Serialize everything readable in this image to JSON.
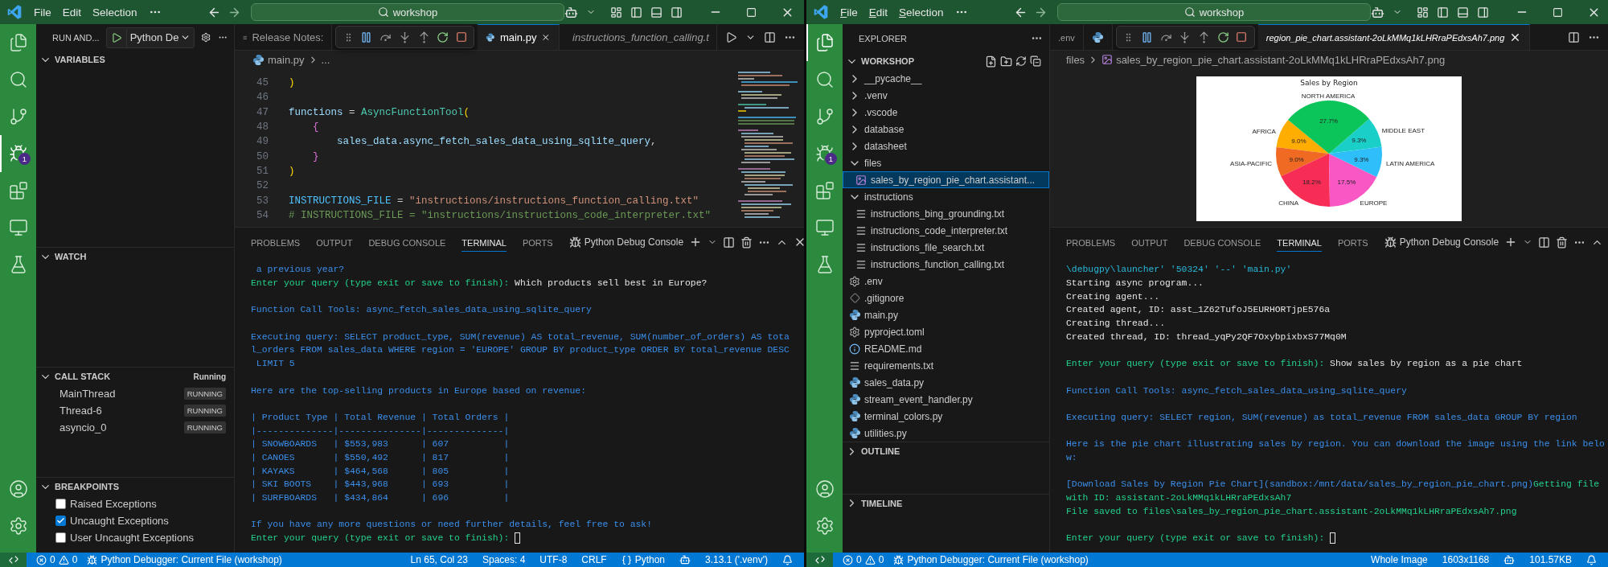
{
  "left_window": {
    "title_bar": {
      "menu": [
        "File",
        "Edit",
        "Selection"
      ],
      "mnemonics": false,
      "search": "workshop"
    },
    "activity_bar": {
      "items": [
        {
          "kind": "explorer",
          "selected": false
        },
        {
          "kind": "search",
          "selected": false
        },
        {
          "kind": "source_control",
          "selected": false
        },
        {
          "kind": "run_debug",
          "selected": true,
          "badge": "1"
        },
        {
          "kind": "extensions",
          "selected": false
        },
        {
          "kind": "remote",
          "selected": false
        },
        {
          "kind": "testing",
          "selected": false
        }
      ]
    },
    "run_panel": {
      "title": "RUN AND...",
      "configuration": "Python De",
      "variables": {
        "title": "VARIABLES",
        "expanded": true
      },
      "watch": {
        "title": "WATCH",
        "expanded": true
      },
      "call_stack": {
        "title": "CALL STACK",
        "expanded": true,
        "status": "Running",
        "threads": [
          {
            "name": "MainThread",
            "state": "RUNNING"
          },
          {
            "name": "Thread-6",
            "state": "RUNNING"
          },
          {
            "name": "asyncio_0",
            "state": "RUNNING"
          }
        ]
      },
      "breakpoints": {
        "title": "BREAKPOINTS",
        "expanded": true,
        "items": [
          {
            "label": "Raised Exceptions",
            "checked": false
          },
          {
            "label": "Uncaught Exceptions",
            "checked": true
          },
          {
            "label": "User Uncaught Exceptions",
            "checked": false
          }
        ]
      }
    },
    "editor": {
      "tabs": [
        {
          "kind": "text",
          "label": "Release Notes:",
          "selected": false,
          "preview": false
        },
        {
          "kind": "python",
          "label": "main.py",
          "selected": true,
          "preview": false
        },
        {
          "kind": "text",
          "label": "instructions_function_calling.t",
          "selected": false,
          "preview": true
        }
      ],
      "breadcrumb": [
        {
          "kind": "python",
          "label": "main.py"
        },
        {
          "kind": "plain",
          "label": "..."
        }
      ],
      "code": [
        {
          "number": "45",
          "tokens": [
            {
              "kind": "bracket",
              "text": ")"
            }
          ]
        },
        {
          "number": "46"
        },
        {
          "number": "47",
          "tokens": [
            {
              "kind": "variable",
              "text": "functions"
            },
            {
              "kind": "plain",
              "text": " = "
            },
            {
              "kind": "class",
              "text": "AsyncFunctionTool"
            },
            {
              "kind": "bracket",
              "text": "("
            }
          ]
        },
        {
          "number": "48",
          "tokens": [
            {
              "kind": "brace",
              "text": "    {"
            }
          ]
        },
        {
          "number": "49",
          "tokens": [
            {
              "kind": "variable",
              "text": "        sales_data.async_fetch_sales_data_using_sqlite_query"
            },
            {
              "kind": "plain",
              "text": ","
            }
          ]
        },
        {
          "number": "50",
          "tokens": [
            {
              "kind": "brace",
              "text": "    }"
            }
          ]
        },
        {
          "number": "51",
          "tokens": [
            {
              "kind": "bracket",
              "text": ")"
            }
          ]
        },
        {
          "number": "52"
        },
        {
          "number": "53",
          "tokens": [
            {
              "kind": "constant",
              "text": "INSTRUCTIONS_FILE"
            },
            {
              "kind": "plain",
              "text": " = "
            },
            {
              "kind": "string",
              "text": "\"instructions/instructions_function_calling.txt\""
            }
          ]
        },
        {
          "number": "54",
          "tokens": [
            {
              "kind": "comment",
              "text": "# INSTRUCTIONS_FILE = \"instructions/instructions_code_interpreter.txt\""
            }
          ]
        }
      ]
    },
    "panel": {
      "tabs": [
        {
          "label": "PROBLEMS",
          "selected": false
        },
        {
          "label": "OUTPUT",
          "selected": false
        },
        {
          "label": "DEBUG CONSOLE",
          "selected": false
        },
        {
          "label": "TERMINAL",
          "selected": true
        },
        {
          "label": "PORTS",
          "selected": false
        }
      ],
      "terminal": "Python Debug Console",
      "lines": [
        {
          "kind": "text",
          "segments": [
            {
              "kind": "info",
              "text": " a previous year?"
            }
          ]
        },
        {
          "kind": "text",
          "segments": [
            {
              "kind": "prompt",
              "text": "Enter your query (type exit or save to finish): "
            },
            {
              "kind": "input",
              "text": "Which products sell best in Europe?"
            }
          ]
        },
        {
          "kind": "blank"
        },
        {
          "kind": "text",
          "segments": [
            {
              "kind": "info",
              "text": "Function Call Tools: async_fetch_sales_data_using_sqlite_query"
            }
          ]
        },
        {
          "kind": "blank"
        },
        {
          "kind": "text",
          "segments": [
            {
              "kind": "info",
              "text": "Executing query: SELECT product_type, SUM(revenue) AS total_revenue, SUM(number_of_orders) AS tota"
            }
          ]
        },
        {
          "kind": "text",
          "segments": [
            {
              "kind": "info",
              "text": "l_orders FROM sales_data WHERE region = 'EUROPE' GROUP BY product_type ORDER BY total_revenue DESC"
            }
          ]
        },
        {
          "kind": "text",
          "segments": [
            {
              "kind": "info",
              "text": " LIMIT 5"
            }
          ]
        },
        {
          "kind": "blank"
        },
        {
          "kind": "text",
          "segments": [
            {
              "kind": "info",
              "text": "Here are the top-selling products in Europe based on revenue:"
            }
          ]
        },
        {
          "kind": "blank"
        },
        {
          "kind": "text",
          "segments": [
            {
              "kind": "info",
              "text": "| Product Type | Total Revenue | Total Orders |"
            }
          ]
        },
        {
          "kind": "text",
          "segments": [
            {
              "kind": "info",
              "text": "|--------------|---------------|--------------|"
            }
          ]
        },
        {
          "kind": "text",
          "segments": [
            {
              "kind": "info",
              "text": "| SNOWBOARDS   | $553,983      | 607          |"
            }
          ]
        },
        {
          "kind": "text",
          "segments": [
            {
              "kind": "info",
              "text": "| CANOES       | $550,492      | 817          |"
            }
          ]
        },
        {
          "kind": "text",
          "segments": [
            {
              "kind": "info",
              "text": "| KAYAKS       | $464,568      | 805          |"
            }
          ]
        },
        {
          "kind": "text",
          "segments": [
            {
              "kind": "info",
              "text": "| SKI BOOTS    | $443,968      | 693          |"
            }
          ]
        },
        {
          "kind": "text",
          "segments": [
            {
              "kind": "info",
              "text": "| SURFBOARDS   | $434,864      | 696          |"
            }
          ]
        },
        {
          "kind": "blank"
        },
        {
          "kind": "text",
          "segments": [
            {
              "kind": "info",
              "text": "If you have any more questions or need further details, feel free to ask!"
            }
          ]
        },
        {
          "kind": "text",
          "segments": [
            {
              "kind": "prompt",
              "text": "Enter your query (type exit or save to finish): "
            }
          ],
          "cursor": true
        }
      ]
    },
    "status_bar": {
      "left": [
        {
          "kind": "remote"
        },
        {
          "kind": "problems",
          "errors": "0",
          "warnings": "0"
        },
        {
          "kind": "debug",
          "text": "Python Debugger: Current File (workshop)"
        }
      ],
      "right": [
        {
          "kind": "text",
          "text": "Ln 65, Col 23"
        },
        {
          "kind": "text",
          "text": "Spaces: 4"
        },
        {
          "kind": "text",
          "text": "UTF-8"
        },
        {
          "kind": "text",
          "text": "CRLF"
        },
        {
          "kind": "language",
          "text": "Python"
        },
        {
          "kind": "copilot"
        },
        {
          "kind": "text",
          "text": "3.13.1 ('.venv')"
        },
        {
          "kind": "bell"
        }
      ]
    }
  },
  "right_window": {
    "title_bar": {
      "menu": [
        "File",
        "Edit",
        "Selection"
      ],
      "mnemonics": true,
      "search": "workshop"
    },
    "activity_bar": {
      "items": [
        {
          "kind": "explorer",
          "selected": true
        },
        {
          "kind": "search",
          "selected": false
        },
        {
          "kind": "source_control",
          "selected": false
        },
        {
          "kind": "run_debug",
          "selected": false,
          "badge": "1"
        },
        {
          "kind": "extensions",
          "selected": false
        },
        {
          "kind": "remote",
          "selected": false
        },
        {
          "kind": "testing",
          "selected": false
        }
      ]
    },
    "explorer": {
      "title": "EXPLORER",
      "workspace": "WORKSHOP",
      "tree": [
        {
          "kind": "folder",
          "name": "__pycache__",
          "expanded": false,
          "selected": false
        },
        {
          "kind": "folder",
          "name": ".venv",
          "expanded": false,
          "selected": false
        },
        {
          "kind": "folder",
          "name": ".vscode",
          "expanded": false,
          "selected": false
        },
        {
          "kind": "folder",
          "name": "database",
          "expanded": false,
          "selected": false
        },
        {
          "kind": "folder",
          "name": "datasheet",
          "expanded": false,
          "selected": false
        },
        {
          "kind": "folder",
          "name": "files",
          "expanded": true,
          "selected": false,
          "children": [
            {
              "kind": "image",
              "name": "sales_by_region_pie_chart.assistant...",
              "selected": true
            }
          ]
        },
        {
          "kind": "folder",
          "name": "instructions",
          "expanded": true,
          "selected": false,
          "children": [
            {
              "kind": "text",
              "name": "instructions_bing_grounding.txt",
              "selected": false
            },
            {
              "kind": "text",
              "name": "instructions_code_interpreter.txt",
              "selected": false
            },
            {
              "kind": "text",
              "name": "instructions_file_search.txt",
              "selected": false
            },
            {
              "kind": "text",
              "name": "instructions_function_calling.txt",
              "selected": false
            }
          ]
        },
        {
          "kind": "settings",
          "name": ".env",
          "selected": false
        },
        {
          "kind": "git",
          "name": ".gitignore",
          "selected": false
        },
        {
          "kind": "python",
          "name": "main.py",
          "selected": false
        },
        {
          "kind": "settings",
          "name": "pyproject.toml",
          "selected": false
        },
        {
          "kind": "info",
          "name": "README.md",
          "selected": false
        },
        {
          "kind": "text",
          "name": "requirements.txt",
          "selected": false
        },
        {
          "kind": "python",
          "name": "sales_data.py",
          "selected": false
        },
        {
          "kind": "python",
          "name": "stream_event_handler.py",
          "selected": false
        },
        {
          "kind": "python",
          "name": "terminal_colors.py",
          "selected": false
        },
        {
          "kind": "python",
          "name": "utilities.py",
          "selected": false
        }
      ],
      "outline": {
        "title": "OUTLINE",
        "expanded": false
      },
      "timeline": {
        "title": "TIMELINE",
        "expanded": false
      }
    },
    "editor": {
      "tabs": [
        {
          "kind": "plain",
          "label": ".env",
          "selected": false,
          "preview": false
        },
        {
          "kind": "python",
          "selected": false
        },
        {
          "kind": "plain",
          "label": "region_pie_chart.assistant-2oLkMMq1kLHRraPEdxsAh7.png",
          "selected": true,
          "preview": true
        }
      ],
      "breadcrumb": [
        {
          "kind": "plain",
          "label": "files"
        },
        {
          "kind": "image",
          "label": "sales_by_region_pie_chart.assistant-2oLkMMq1kLHRraPEdxsAh7.png"
        }
      ],
      "image": {
        "chart_data": {
          "type": "pie",
          "title": "Sales by Region",
          "categories": [
            "AFRICA",
            "ASIA-PACIFIC",
            "CHINA",
            "EUROPE",
            "LATIN AMERICA",
            "MIDDLE EAST",
            "NORTH AMERICA"
          ],
          "values": [
            9.0,
            9.0,
            18.2,
            17.5,
            9.3,
            9.3,
            27.7
          ],
          "colors": [
            "#ffad00",
            "#f06a24",
            "#f72d55",
            "#f857c4",
            "#2ebefa",
            "#1bcfc9",
            "#0bc45a"
          ],
          "value_labels": [
            "9.0%",
            "9.0%",
            "18.2%",
            "17.5%",
            "9.3%",
            "9.3%",
            "27.7%"
          ]
        }
      }
    },
    "panel": {
      "tabs": [
        {
          "label": "PROBLEMS",
          "selected": false
        },
        {
          "label": "OUTPUT",
          "selected": false
        },
        {
          "label": "DEBUG CONSOLE",
          "selected": false
        },
        {
          "label": "TERMINAL",
          "selected": true
        },
        {
          "label": "PORTS",
          "selected": false
        }
      ],
      "terminal": "Python Debug Console",
      "lines": [
        {
          "kind": "text",
          "segments": [
            {
              "kind": "path",
              "text": "\\debugpy\\launcher' '50324' '--' 'main.py'"
            }
          ]
        },
        {
          "kind": "text",
          "segments": [
            {
              "kind": "plain",
              "text": "Starting async program..."
            }
          ]
        },
        {
          "kind": "text",
          "segments": [
            {
              "kind": "plain",
              "text": "Creating agent..."
            }
          ]
        },
        {
          "kind": "text",
          "segments": [
            {
              "kind": "plain",
              "text": "Created agent, ID: asst_1Z62TufoJ5EURHORTjpE576a"
            }
          ]
        },
        {
          "kind": "text",
          "segments": [
            {
              "kind": "plain",
              "text": "Creating thread..."
            }
          ]
        },
        {
          "kind": "text",
          "segments": [
            {
              "kind": "plain",
              "text": "Created thread, ID: thread_yqPy2QF7OxybpixbxS77Mq0M"
            }
          ]
        },
        {
          "kind": "blank"
        },
        {
          "kind": "text",
          "segments": [
            {
              "kind": "prompt",
              "text": "Enter your query (type exit or save to finish): "
            },
            {
              "kind": "input",
              "text": "Show sales by region as a pie chart"
            }
          ]
        },
        {
          "kind": "blank"
        },
        {
          "kind": "text",
          "segments": [
            {
              "kind": "info",
              "text": "Function Call Tools: async_fetch_sales_data_using_sqlite_query"
            }
          ]
        },
        {
          "kind": "blank"
        },
        {
          "kind": "text",
          "segments": [
            {
              "kind": "info",
              "text": "Executing query: SELECT region, SUM(revenue) as total_revenue FROM sales_data GROUP BY region"
            }
          ]
        },
        {
          "kind": "blank"
        },
        {
          "kind": "text",
          "segments": [
            {
              "kind": "info",
              "text": "Here is the pie chart illustrating sales by region. You can download the image using the link belo"
            }
          ]
        },
        {
          "kind": "text",
          "segments": [
            {
              "kind": "info",
              "text": "w:"
            }
          ]
        },
        {
          "kind": "blank"
        },
        {
          "kind": "text",
          "segments": [
            {
              "kind": "info",
              "text": "[Download Sales by Region Pie Chart](sandbox:/mnt/data/sales_by_region_pie_chart.png)"
            },
            {
              "kind": "success",
              "text": "Getting file"
            }
          ]
        },
        {
          "kind": "text",
          "segments": [
            {
              "kind": "success",
              "text": "with ID: assistant-2oLkMMq1kLHRraPEdxsAh7"
            }
          ]
        },
        {
          "kind": "text",
          "segments": [
            {
              "kind": "success",
              "text": "File saved to files\\sales_by_region_pie_chart.assistant-2oLkMMq1kLHRraPEdxsAh7.png"
            }
          ]
        },
        {
          "kind": "blank"
        },
        {
          "kind": "text",
          "segments": [
            {
              "kind": "prompt",
              "text": "Enter your query (type exit or save to finish): "
            }
          ],
          "cursor": true
        }
      ]
    },
    "status_bar": {
      "left": [
        {
          "kind": "remote"
        },
        {
          "kind": "problems",
          "errors": "0",
          "warnings": "0"
        },
        {
          "kind": "debug",
          "text": "Python Debugger: Current File (workshop)"
        }
      ],
      "right": [
        {
          "kind": "text",
          "text": "Whole Image"
        },
        {
          "kind": "text",
          "text": "1603x1168"
        },
        {
          "kind": "copilot"
        },
        {
          "kind": "text",
          "text": "101.57KB"
        },
        {
          "kind": "bell"
        }
      ]
    }
  }
}
